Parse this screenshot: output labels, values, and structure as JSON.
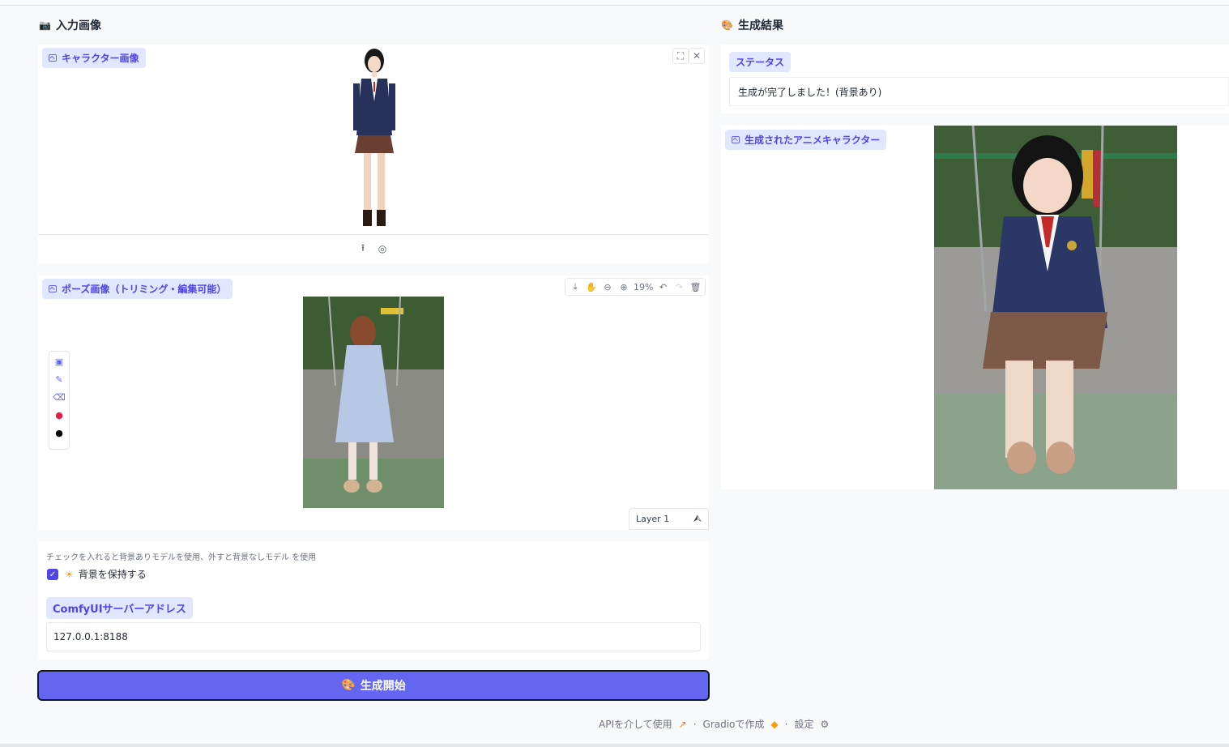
{
  "left": {
    "title": "入力画像",
    "title_icon": "camera-icon",
    "character_image": {
      "label": "キャラクター画像"
    },
    "pose_image": {
      "label": "ポーズ画像（トリミング・編集可能）",
      "zoom": "19%",
      "layer": "Layer 1"
    },
    "options": {
      "hint": "チェックを入れると背景ありモデルを使用、外すと背景なしモデル を使用",
      "keep_background_label": "背景を保持する",
      "keep_background_checked": true,
      "server_label": "ComfyUIサーバーアドレス",
      "server_value": "127.0.0.1:8188"
    },
    "generate_button": "生成開始"
  },
  "right": {
    "title": "生成結果",
    "title_icon": "palette-icon",
    "status_label": "ステータス",
    "status_value": "生成が完了しました！(背景あり)",
    "result_label": "生成されたアニメキャラクター"
  },
  "footer": {
    "api": "APIを介して使用",
    "gradio": "Gradioで作成",
    "settings": "設定"
  },
  "colors": {
    "accent": "#6366f1",
    "chip_bg": "#e0e7ff",
    "chip_text": "#4f46e5"
  }
}
